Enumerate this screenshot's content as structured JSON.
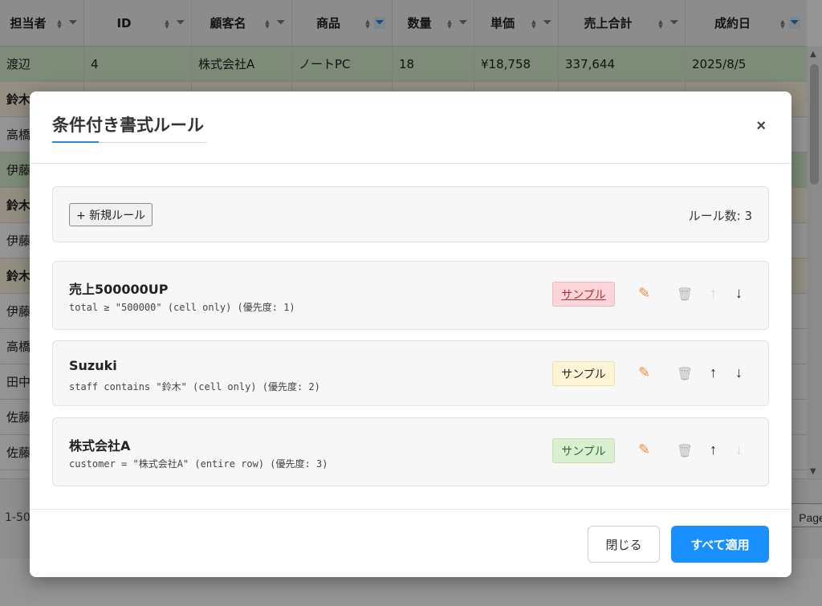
{
  "table": {
    "columns": [
      "担当者",
      "ID",
      "顧客名",
      "商品",
      "数量",
      "単価",
      "売上合計",
      "成約日"
    ],
    "filter_active": [
      false,
      false,
      false,
      true,
      false,
      false,
      false,
      true
    ],
    "rows": [
      [
        "渡辺",
        "4",
        "株式会社A",
        "ノートPC",
        "18",
        "¥18,758",
        "337,644",
        "2025/8/5"
      ],
      [
        "鈴木",
        "",
        "",
        "",
        "",
        "",
        "",
        ""
      ],
      [
        "高橋",
        "",
        "",
        "",
        "",
        "",
        "",
        ""
      ],
      [
        "伊藤",
        "",
        "",
        "",
        "",
        "",
        "",
        ""
      ],
      [
        "鈴木",
        "",
        "",
        "",
        "",
        "",
        "",
        ""
      ],
      [
        "伊藤",
        "",
        "",
        "",
        "",
        "",
        "",
        ""
      ],
      [
        "鈴木",
        "",
        "",
        "",
        "",
        "",
        "",
        ""
      ],
      [
        "伊藤",
        "",
        "",
        "",
        "",
        "",
        "",
        ""
      ],
      [
        "高橋",
        "",
        "",
        "",
        "",
        "",
        "",
        ""
      ],
      [
        "田中",
        "",
        "",
        "",
        "",
        "",
        "",
        ""
      ],
      [
        "佐藤",
        "",
        "",
        "",
        "",
        "",
        "",
        ""
      ],
      [
        "佐藤",
        "",
        "",
        "",
        "",
        "",
        "",
        ""
      ]
    ],
    "row_styles": [
      "green",
      "bold",
      "",
      "green",
      "bold",
      "",
      "bold",
      "",
      "",
      "",
      "",
      ""
    ]
  },
  "pager": {
    "range": "1-50",
    "page_button": "Page"
  },
  "modal": {
    "title": "条件付き書式ルール",
    "close_icon": "×",
    "new_rule_label": "+ 新規ルール",
    "rule_count_label": "ルール数: 3",
    "rules": [
      {
        "name": "売上500000UP",
        "desc": "total ≥ \"500000\" (cell only) (優先度: 1)",
        "sample_label": "サンプル",
        "sample_bg": "#fbd5d8",
        "sample_border": "#f0b8bc",
        "sample_color": "#b0303a",
        "up_enabled": false,
        "down_enabled": true
      },
      {
        "name": "Suzuki",
        "desc": "staff contains \"鈴木\" (cell only) (優先度: 2)",
        "sample_label": "サンプル",
        "sample_bg": "#fff4d6",
        "sample_border": "#f0dfa8",
        "sample_color": "#222222",
        "up_enabled": true,
        "down_enabled": true
      },
      {
        "name": "株式会社A",
        "desc": "customer = \"株式会社A\" (entire row) (優先度: 3)",
        "sample_label": "サンプル",
        "sample_bg": "#d9efcf",
        "sample_border": "#c2e2b3",
        "sample_color": "#2f6a2a",
        "up_enabled": true,
        "down_enabled": false
      }
    ],
    "icons": {
      "edit": "✎",
      "delete": "🗑",
      "up": "↑",
      "down": "↓"
    },
    "footer": {
      "close_label": "閉じる",
      "apply_label": "すべて適用"
    }
  },
  "colors": {
    "accent": "#1a90ff",
    "row_green": "#d9efcf"
  }
}
